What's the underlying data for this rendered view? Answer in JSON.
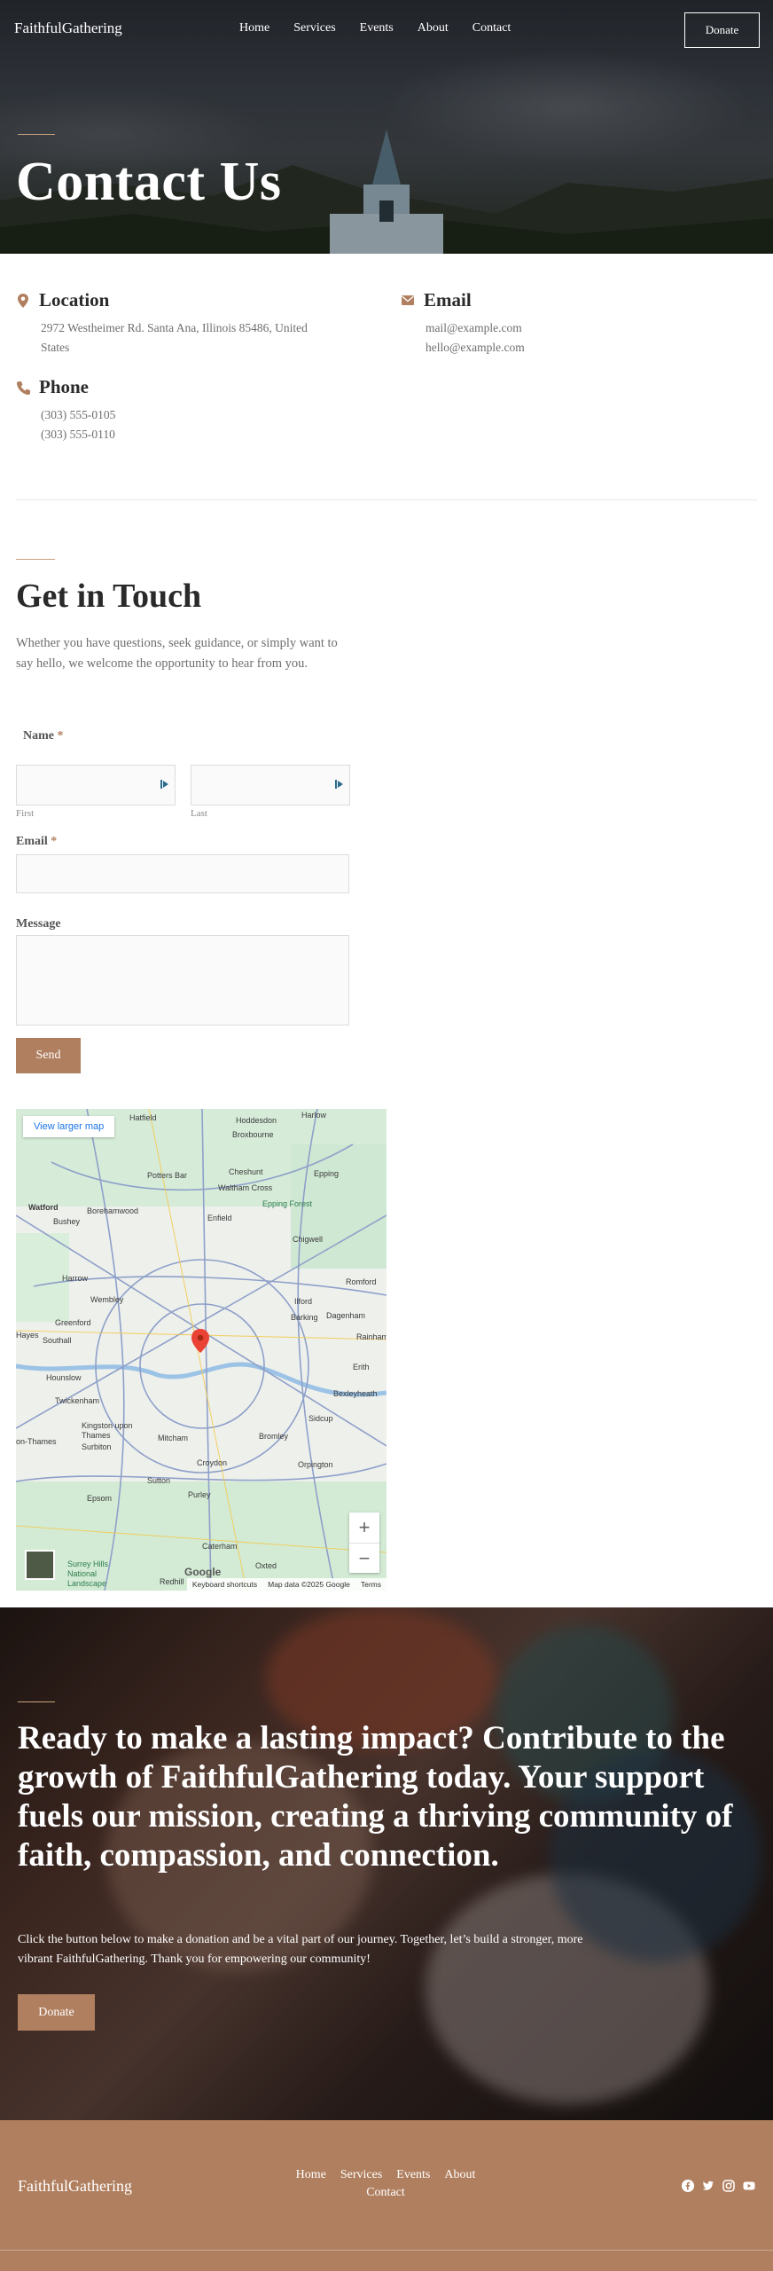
{
  "nav": {
    "logo": "FaithfulGathering",
    "links": [
      "Home",
      "Services",
      "Events",
      "About",
      "Contact"
    ],
    "donate_label": "Donate"
  },
  "hero": {
    "title": "Contact Us"
  },
  "contact": {
    "location": {
      "title": "Location",
      "lines": [
        "2972 Westheimer Rd. Santa Ana, Illinois 85486, United",
        "States"
      ]
    },
    "email": {
      "title": "Email",
      "lines": [
        "mail@example.com",
        "hello@example.com"
      ]
    },
    "phone": {
      "title": "Phone",
      "lines": [
        "(303) 555-0105",
        "(303) 555-0110"
      ]
    }
  },
  "touch": {
    "title": "Get in Touch",
    "text": "Whether you have questions, seek guidance, or simply want to say hello, we welcome the opportunity to hear from you."
  },
  "form": {
    "name_label": "Name",
    "required_mark": "*",
    "first_label": "First",
    "last_label": "Last",
    "email_label": "Email",
    "message_label": "Message",
    "send_label": "Send"
  },
  "map": {
    "larger_map": "View larger map",
    "google": "Google",
    "attribution": [
      "Keyboard shortcuts",
      "Map data ©2025 Google",
      "Terms"
    ],
    "zoom_in": "+",
    "zoom_out": "−",
    "labels": [
      "Hatfield",
      "Hoddesdon",
      "Harlow",
      "Broxbourne",
      "Potters Bar",
      "Cheshunt",
      "Epping",
      "Waltham Cross",
      "Watford",
      "Borehamwood",
      "Bushey",
      "Enfield",
      "Epping Forest",
      "Chigwell",
      "Harrow",
      "Romford",
      "Wembley",
      "Ilford",
      "Barking",
      "Dagenham",
      "Greenford",
      "Southall",
      "Rainham",
      "Erith",
      "Hounslow",
      "Twickenham",
      "Bexleyheath",
      "Sidcup",
      "Kingston upon Thames",
      "Surbiton",
      "Mitcham",
      "Bromley",
      "Croydon",
      "Orpington",
      "Sutton",
      "Epsom",
      "Purley",
      "Caterham",
      "Oxted",
      "Redhill",
      "Surrey Hills National Landscape",
      "Hayes",
      "on-Thames"
    ]
  },
  "cta": {
    "title": "Ready to make a lasting impact? Contribute to the growth of FaithfulGathering today. Your support fuels our mission, creating a thriving community of faith, compassion, and connection.",
    "text": "Click the button below to make a donation and be a vital part of our journey. Together, let’s build a stronger, more vibrant FaithfulGathering. Thank you for empowering our community!",
    "button_label": "Donate"
  },
  "footer": {
    "logo": "FaithfulGathering",
    "links": [
      "Home",
      "Services",
      "Events",
      "About",
      "Contact"
    ],
    "social": [
      "facebook-icon",
      "twitter-icon",
      "instagram-icon",
      "youtube-icon"
    ]
  },
  "colors": {
    "accent": "#b07f5f",
    "text": "#2a2a2a",
    "muted": "#6e6e6e"
  }
}
